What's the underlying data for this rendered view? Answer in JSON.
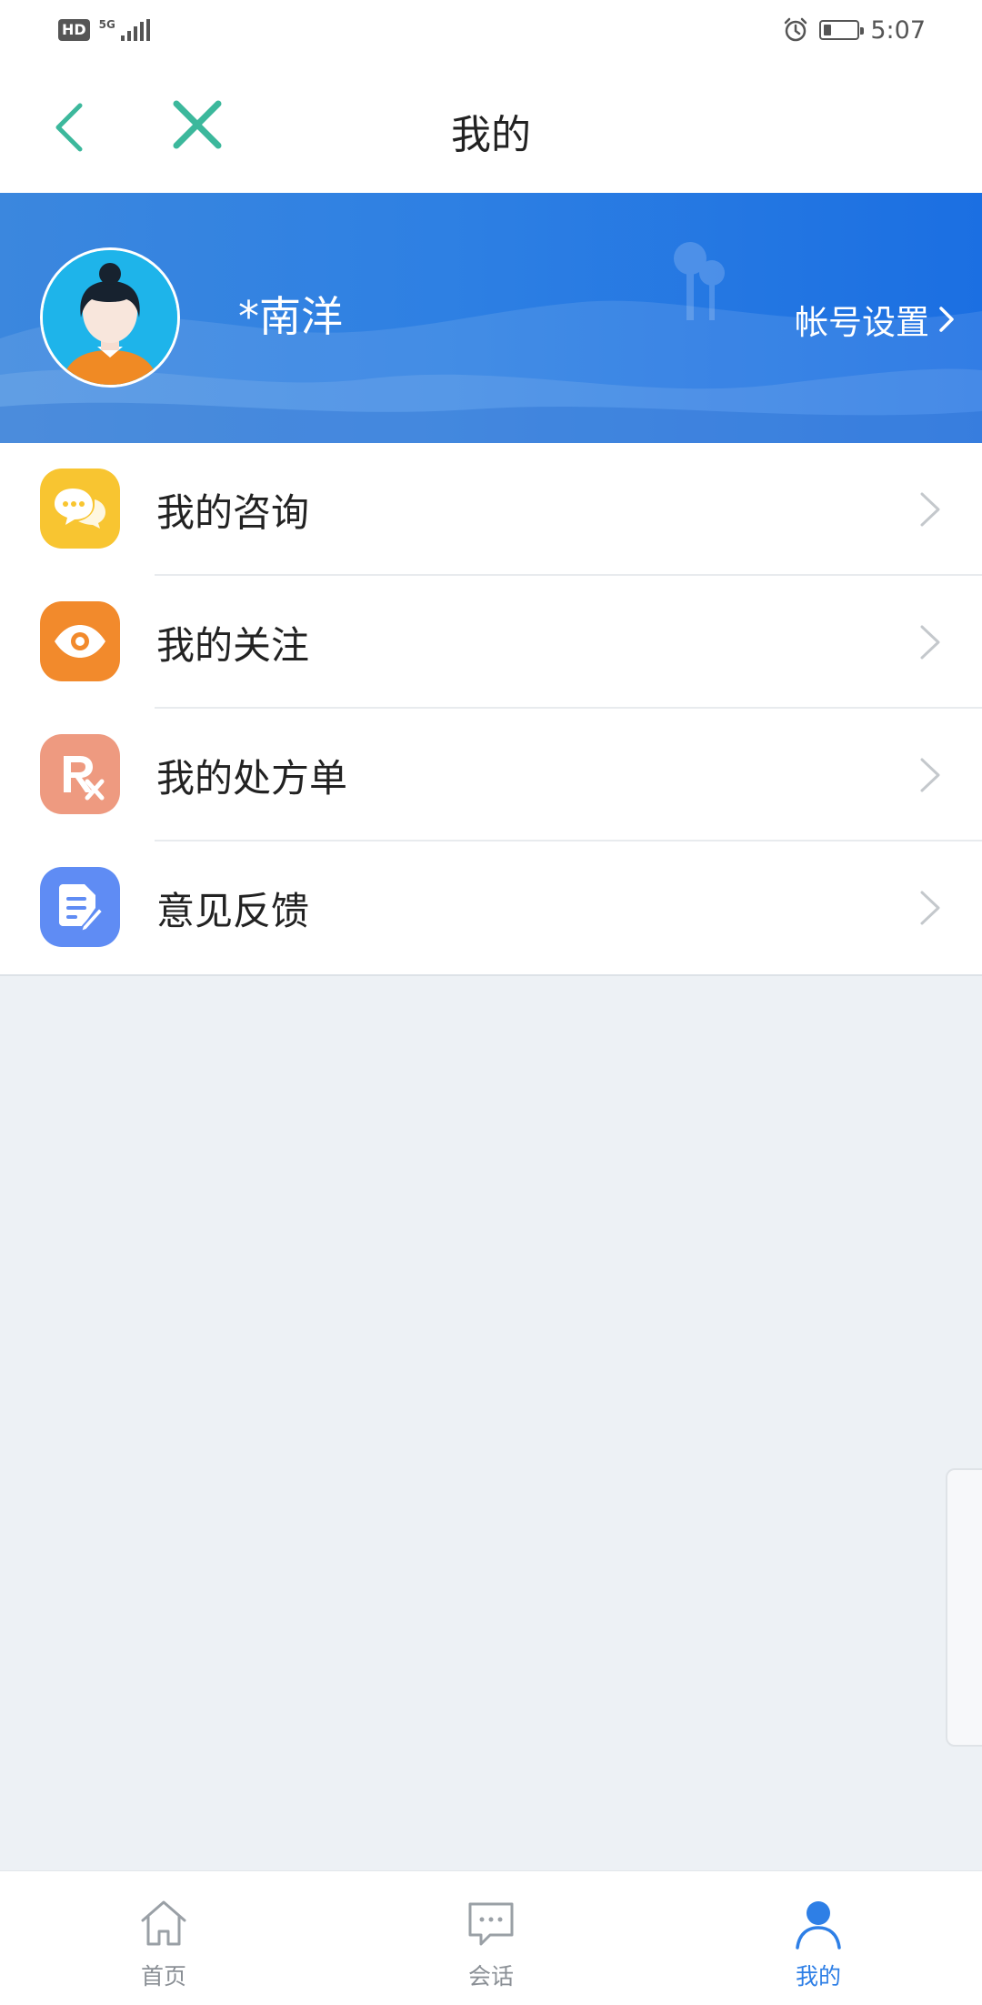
{
  "status_bar": {
    "hd": "HD",
    "network": "5G",
    "time": "5:07"
  },
  "header": {
    "title": "我的"
  },
  "profile": {
    "username": "*南洋",
    "account_settings": "帐号设置"
  },
  "menu": {
    "items": [
      {
        "label": "我的咨询",
        "icon": "chat-bubble-icon",
        "color": "#f8c531"
      },
      {
        "label": "我的关注",
        "icon": "eye-icon",
        "color": "#f28a2c"
      },
      {
        "label": "我的处方单",
        "icon": "prescription-icon",
        "color": "#ee9a80"
      },
      {
        "label": "意见反馈",
        "icon": "feedback-icon",
        "color": "#5f8cf4"
      }
    ]
  },
  "tabbar": {
    "items": [
      {
        "label": "首页",
        "icon": "home-icon",
        "active": false
      },
      {
        "label": "会话",
        "icon": "message-icon",
        "active": false
      },
      {
        "label": "我的",
        "icon": "person-icon",
        "active": true
      }
    ]
  },
  "colors": {
    "accent": "#2e7fe6",
    "nav_icon": "#3cb89c",
    "page_bg": "#edf1f5"
  }
}
